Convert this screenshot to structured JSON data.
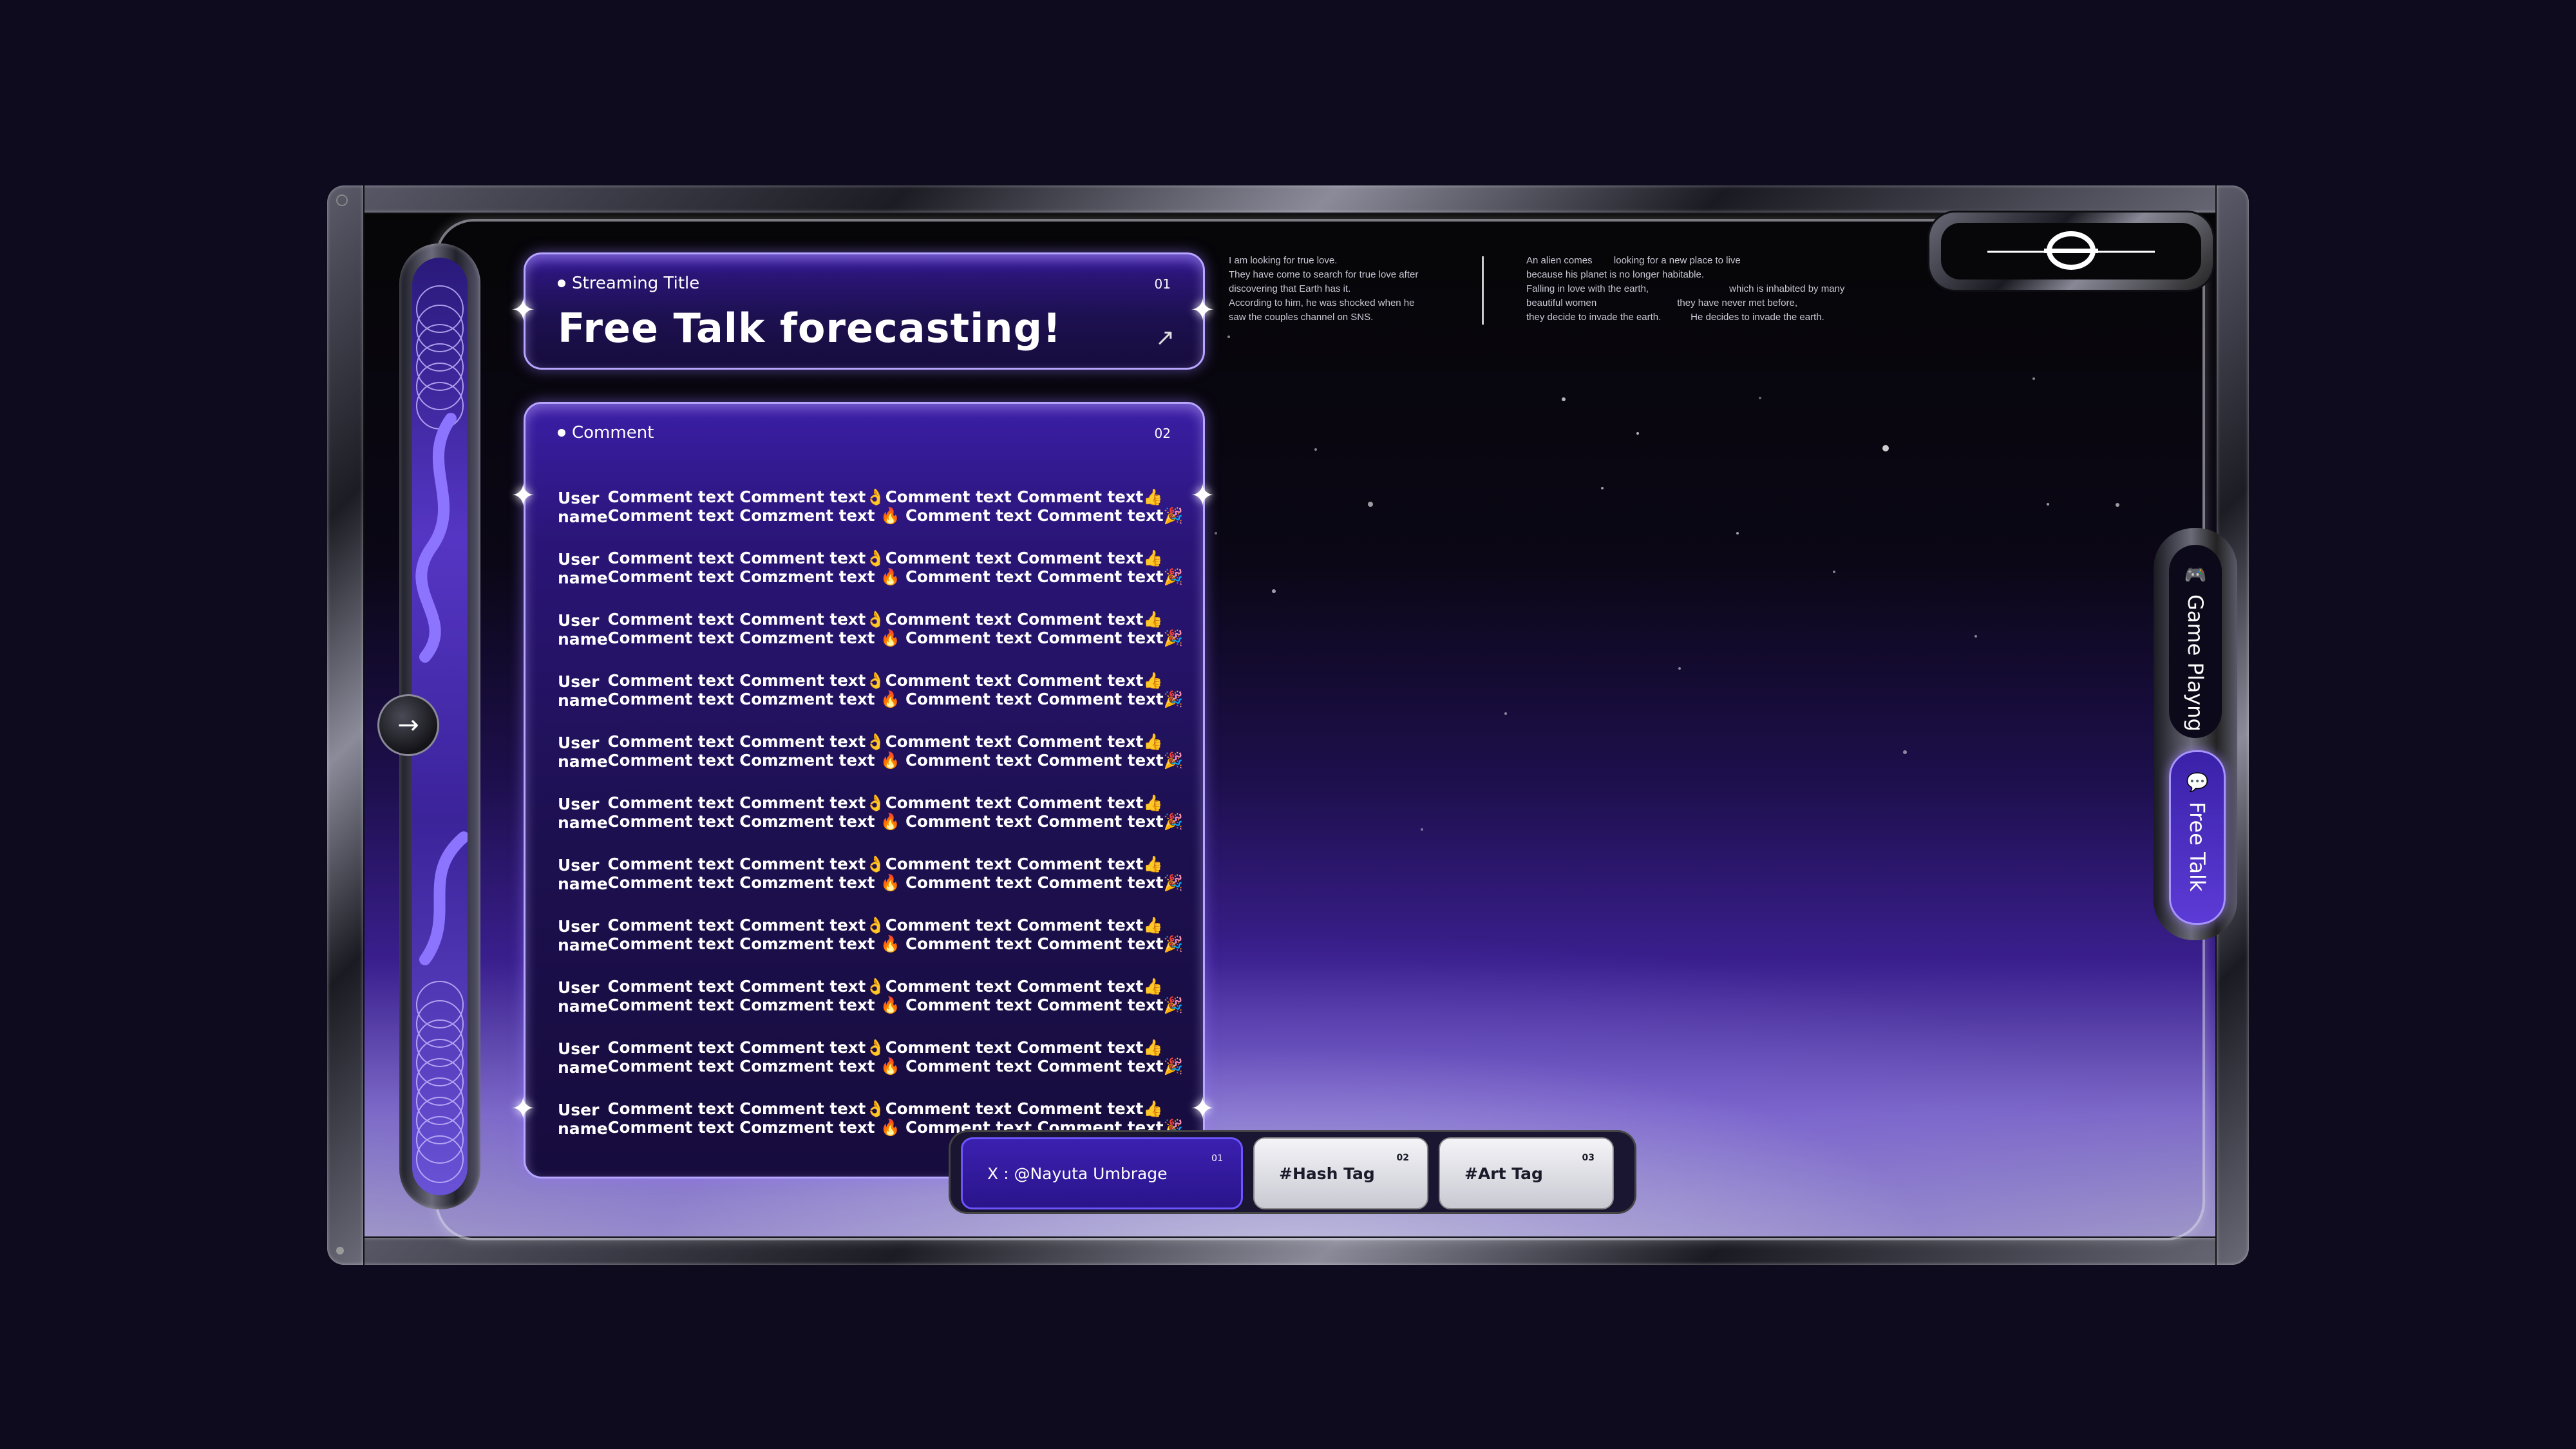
{
  "title_panel": {
    "label": "Streaming Title",
    "number": "01",
    "title": "Free Talk forecasting!"
  },
  "comment_panel": {
    "label": "Comment",
    "number": "02",
    "comments": [
      {
        "user": "User name",
        "line1": "Comment text Comment text👌Comment text Comment text👍",
        "line2": "Comment text Comzment text 🔥 Comment text Comment text🎉"
      },
      {
        "user": "User name",
        "line1": "Comment text Comment text👌Comment text Comment text👍",
        "line2": "Comment text Comzment text 🔥 Comment text Comment text🎉"
      },
      {
        "user": "User name",
        "line1": "Comment text Comment text👌Comment text Comment text👍",
        "line2": "Comment text Comzment text 🔥 Comment text Comment text🎉"
      },
      {
        "user": "User name",
        "line1": "Comment text Comment text👌Comment text Comment text👍",
        "line2": "Comment text Comzment text 🔥 Comment text Comment text🎉"
      },
      {
        "user": "User name",
        "line1": "Comment text Comment text👌Comment text Comment text👍",
        "line2": "Comment text Comzment text 🔥 Comment text Comment text🎉"
      },
      {
        "user": "User name",
        "line1": "Comment text Comment text👌Comment text Comment text👍",
        "line2": "Comment text Comzment text 🔥 Comment text Comment text🎉"
      },
      {
        "user": "User name",
        "line1": "Comment text Comment text👌Comment text Comment text👍",
        "line2": "Comment text Comzment text 🔥 Comment text Comment text🎉"
      },
      {
        "user": "User name",
        "line1": "Comment text Comment text👌Comment text Comment text👍",
        "line2": "Comment text Comzment text 🔥 Comment text Comment text🎉"
      },
      {
        "user": "User name",
        "line1": "Comment text Comment text👌Comment text Comment text👍",
        "line2": "Comment text Comzment text 🔥 Comment text Comment text🎉"
      },
      {
        "user": "User name",
        "line1": "Comment text Comment text👌Comment text Comment text👍",
        "line2": "Comment text Comzment text 🔥 Comment text Comment text🎉"
      },
      {
        "user": "User name",
        "line1": "Comment text Comment text👌Comment text Comment text👍",
        "line2": "Comment text Comzment text 🔥 Comment text Comment text🎉"
      }
    ]
  },
  "story": {
    "left": "I am looking for true love.\nThey have come to search for true love after\ndiscovering that Earth has it.\nAccording to him, he was shocked when he\nsaw the couples channel on SNS.",
    "right": "An alien comes        looking for a new place to live\nbecause his planet is no longer habitable.\nFalling in love with the earth,                              which is inhabited by many\nbeautiful women                              they have never met before,\nthey decide to invade the earth.           He decides to invade the earth."
  },
  "tabs": [
    {
      "label": "Game Playng",
      "icon": "gamepad-icon"
    },
    {
      "label": "Free Talk",
      "icon": "chat-bubble-icon"
    }
  ],
  "tags": [
    {
      "label": "X : @Nayuta Umbrage",
      "number": "01"
    },
    {
      "label": "#Hash Tag",
      "number": "02"
    },
    {
      "label": "#Art Tag",
      "number": "03"
    }
  ],
  "colors": {
    "accent": "#5c3bd6",
    "panel": "#2a1577",
    "background": "#0e0b1f"
  }
}
